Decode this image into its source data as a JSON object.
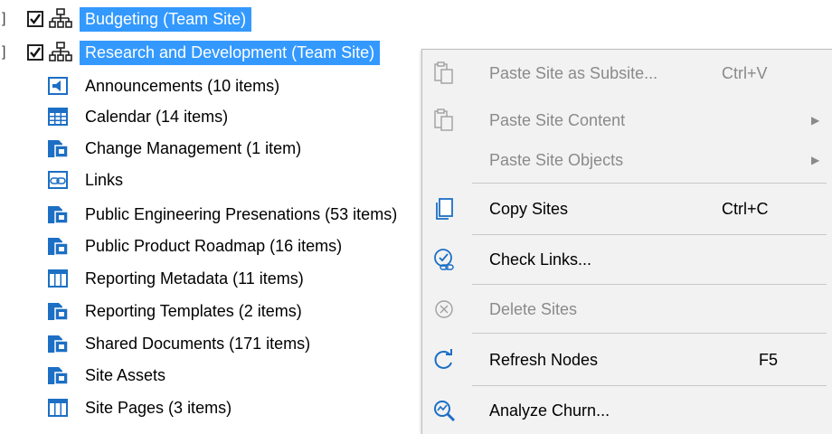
{
  "tree": {
    "sites": [
      {
        "label": "Budgeting (Team Site)",
        "checked": true,
        "expander": "]"
      },
      {
        "label": "Research and Development (Team Site)",
        "checked": true,
        "expander": "]"
      }
    ],
    "children": [
      {
        "label": "Announcements (10 items)",
        "icon": "announcements-list-icon"
      },
      {
        "label": "Calendar (14 items)",
        "icon": "calendar-list-icon"
      },
      {
        "label": "Change Management (1 item)",
        "icon": "document-library-icon"
      },
      {
        "label": "Links",
        "icon": "links-list-icon"
      },
      {
        "label": "Public Engineering Presenations (53 items)",
        "icon": "document-library-icon"
      },
      {
        "label": "Public Product Roadmap (16 items)",
        "icon": "document-library-icon"
      },
      {
        "label": "Reporting Metadata (11 items)",
        "icon": "custom-list-icon"
      },
      {
        "label": "Reporting Templates (2 items)",
        "icon": "document-library-icon"
      },
      {
        "label": "Shared Documents (171 items)",
        "icon": "document-library-icon"
      },
      {
        "label": "Site Assets",
        "icon": "document-library-icon"
      },
      {
        "label": "Site Pages (3 items)",
        "icon": "custom-list-icon"
      }
    ]
  },
  "context_menu": {
    "items": [
      {
        "label": "Paste Site as Subsite...",
        "shortcut": "Ctrl+V",
        "enabled": false,
        "icon": "paste-icon"
      },
      {
        "label": "Paste Site Content",
        "shortcut": "",
        "enabled": false,
        "submenu": "▶",
        "icon": "paste-icon"
      },
      {
        "label": "Paste Site Objects",
        "shortcut": "",
        "enabled": false,
        "submenu": "▶",
        "icon": ""
      },
      {
        "label": "Copy Sites",
        "shortcut": "Ctrl+C",
        "enabled": true,
        "icon": "copy-icon"
      },
      {
        "label": "Check Links...",
        "shortcut": "",
        "enabled": true,
        "icon": "check-links-icon"
      },
      {
        "label": "Delete Sites",
        "shortcut": "",
        "enabled": false,
        "icon": "delete-icon"
      },
      {
        "label": "Refresh Nodes",
        "shortcut": "F5",
        "enabled": true,
        "icon": "refresh-icon"
      },
      {
        "label": "Analyze Churn...",
        "shortcut": "",
        "enabled": true,
        "icon": "analyze-churn-icon"
      }
    ]
  },
  "colors": {
    "selection": "#3399ff",
    "menu_background": "#f2f2f2",
    "disabled_text": "#8a8a8a",
    "icon_blue": "#1c6fc4"
  }
}
